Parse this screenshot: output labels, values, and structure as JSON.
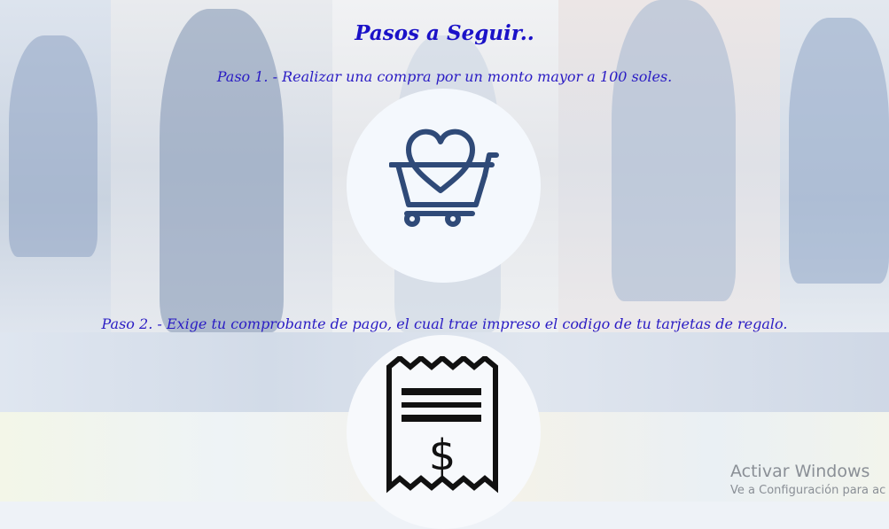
{
  "page": {
    "title": "Pasos a Seguir..",
    "steps": [
      {
        "text": "Paso 1. - Realizar una compra por un monto mayor a 100 soles.",
        "icon": "shopping-cart-heart-icon"
      },
      {
        "text": "Paso 2. - Exige tu comprobante de pago, el cual trae impreso el codigo de tu tarjetas de regalo.",
        "icon": "receipt-dollar-icon"
      }
    ]
  },
  "os_watermark": {
    "line1": "Activar Windows",
    "line2": "Ve a Configuración para ac"
  },
  "colors": {
    "text_primary": "#1b12c8",
    "icon_cart": "#2f4a78",
    "icon_receipt": "#111111"
  }
}
